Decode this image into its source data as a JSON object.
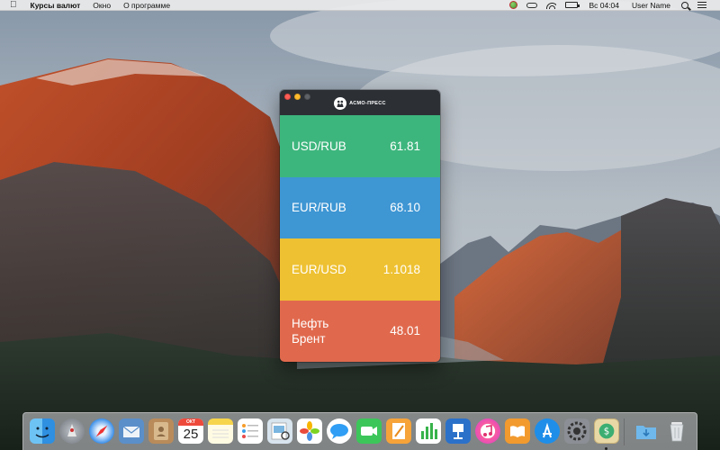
{
  "menubar": {
    "app_name": "Курсы валют",
    "menus": [
      "Окно",
      "О программе"
    ],
    "clock": "Вс 04:04",
    "user": "User Name",
    "status_icons": [
      "globe-icon",
      "glasses-icon",
      "wifi-icon",
      "battery-icon"
    ]
  },
  "window": {
    "logo_text": "АСМО-ПРЕСС",
    "rates": [
      {
        "pair": "USD/RUB",
        "value": "61.81",
        "color": "#3db67d"
      },
      {
        "pair": "EUR/RUB",
        "value": "68.10",
        "color": "#3e96d3"
      },
      {
        "pair": "EUR/USD",
        "value": "1.1018",
        "color": "#eec132"
      },
      {
        "pair": "Нефть\nБрент",
        "value": "48.01",
        "color": "#e0694d"
      }
    ]
  },
  "dock": {
    "calendar_month": "ОКТ",
    "calendar_day": "25",
    "apps": [
      "finder-icon",
      "launchpad-icon",
      "safari-icon",
      "mail-icon",
      "contacts-icon",
      "calendar-icon",
      "notes-icon",
      "reminders-icon",
      "preview-icon",
      "photos-icon",
      "messages-icon",
      "facetime-icon",
      "pages-icon",
      "numbers-icon",
      "keynote-icon",
      "itunes-icon",
      "ibooks-icon",
      "app-store-icon",
      "system-preferences-icon",
      "currency-app-icon",
      "downloads-folder-icon",
      "trash-icon"
    ]
  }
}
